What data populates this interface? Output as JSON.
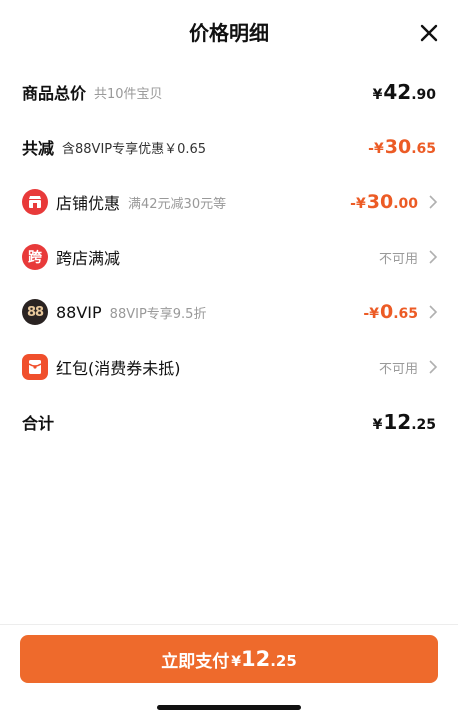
{
  "header": {
    "title": "价格明细",
    "close_icon": "close-icon"
  },
  "goods_total": {
    "label": "商品总价",
    "note": "共10件宝贝",
    "yen": "¥",
    "int": "42",
    "dec": ".90"
  },
  "total_discount": {
    "label": "共减",
    "note": "含88VIP专享优惠￥0.65",
    "yen": "-¥",
    "int": "30",
    "dec": ".65"
  },
  "store_discount": {
    "icon": "store-icon",
    "label": "店铺优惠",
    "note": "满42元减30元等",
    "yen": "-¥",
    "int": "30",
    "dec": ".00"
  },
  "cross_store": {
    "icon_text": "跨",
    "label": "跨店满减",
    "status": "不可用"
  },
  "vip": {
    "icon_text": "88",
    "label": "88VIP",
    "note": "88VIP专享9.5折",
    "yen": "-¥",
    "int": "0",
    "dec": ".65"
  },
  "red_packet": {
    "icon": "red-packet-icon",
    "label": "红包(消费券未抵)",
    "status": "不可用"
  },
  "sum": {
    "label": "合计",
    "yen": "¥",
    "int": "12",
    "dec": ".25"
  },
  "pay_button": {
    "label": "立即支付",
    "yen": "¥",
    "int": "12",
    "dec": ".25"
  },
  "colors": {
    "accent": "#ee6a2c",
    "discount": "#ec5b25",
    "red_icon": "#e83a3a",
    "vip_dark": "#2a2322"
  }
}
